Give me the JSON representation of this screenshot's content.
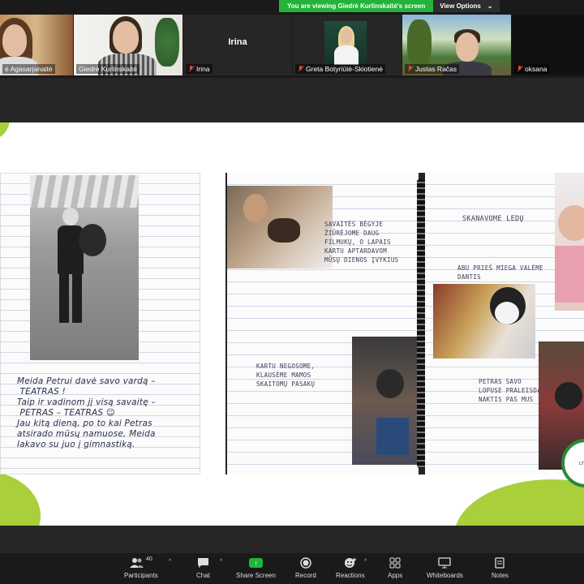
{
  "banner": {
    "text": "You are viewing Giedrė Kurlinskaitė's screen",
    "view_options": "View Options"
  },
  "participants": [
    {
      "name": "ė Agasarjanaitė",
      "muted": false
    },
    {
      "name": "Giedrė Kurlinskaitė",
      "muted": false
    },
    {
      "name": "Irina",
      "muted": true,
      "video_label": "Irina"
    },
    {
      "name": "Greta Botyriūtė-Skiotienė",
      "muted": true
    },
    {
      "name": "Justas Račas",
      "muted": true
    },
    {
      "name": "oksana",
      "muted": true
    }
  ],
  "slide": {
    "left_caption": "Meida Petrui davė savo vardą –\n TEATRAS !\nTaip ir vadinom jį visą savaitę –\n PETRAS – TEATRAS ☺\nJau kitą dieną, po to kai Petras\natsirado mūsų namuose, Meida\nlakavo su juo į gimnastiką.",
    "note1": "SAVAITĖS BĖGYJE\nŽIŪRĖJOME DAUG\nFILMUKŲ, O LAPAIS\nKARTU APTARDAVOM\nMŪSŲ DIENOS ĮVYKIUS",
    "note2": "KARTU NEGOSOME,\nKLAUSĖME MAMOS\nSKAITOMŲ PASAKŲ",
    "note3": "SKANAVOME LEDŲ",
    "note4": "ABU PRIEŠ MIEGA VALĖME\nDANTIS",
    "note5": "PETRAS SAVO\nLOPUSE PRALEISDAVO\nNAKTIS PAS MUS"
  },
  "toolbar": {
    "participants_label": "Participants",
    "participants_count": "40",
    "chat_label": "Chat",
    "share_label": "Share Screen",
    "record_label": "Record",
    "reactions_label": "Reactions",
    "apps_label": "Apps",
    "whiteboards_label": "Whiteboards",
    "notes_label": "Notes"
  },
  "colors": {
    "share_green": "#23b33a",
    "accent_lime": "#a9cf3a",
    "muted_red": "#e44444"
  }
}
